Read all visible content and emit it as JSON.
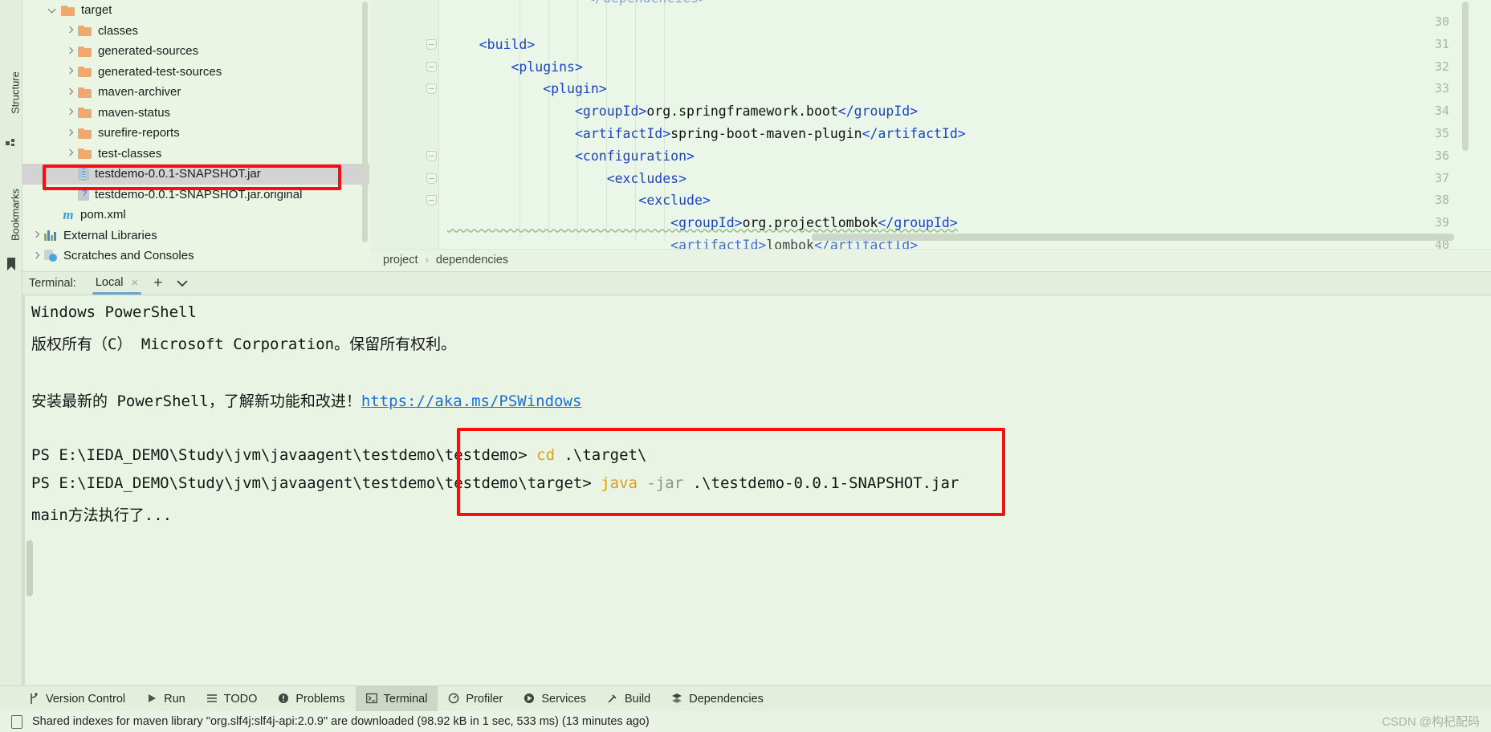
{
  "left_tool_strip": {
    "items": [
      {
        "label": "Structure",
        "icon": "structure-icon"
      },
      {
        "label": "Bookmarks",
        "icon": "bookmark-icon"
      }
    ]
  },
  "project_tree": {
    "rows": [
      {
        "indent": 1,
        "chevron": "down",
        "icon": "folder-icon",
        "label": "target",
        "selected": false
      },
      {
        "indent": 2,
        "chevron": "right",
        "icon": "folder-icon",
        "label": "classes",
        "selected": false
      },
      {
        "indent": 2,
        "chevron": "right",
        "icon": "folder-icon",
        "label": "generated-sources",
        "selected": false
      },
      {
        "indent": 2,
        "chevron": "right",
        "icon": "folder-icon",
        "label": "generated-test-sources",
        "selected": false
      },
      {
        "indent": 2,
        "chevron": "right",
        "icon": "folder-icon",
        "label": "maven-archiver",
        "selected": false
      },
      {
        "indent": 2,
        "chevron": "right",
        "icon": "folder-icon",
        "label": "maven-status",
        "selected": false
      },
      {
        "indent": 2,
        "chevron": "right",
        "icon": "folder-icon",
        "label": "surefire-reports",
        "selected": false
      },
      {
        "indent": 2,
        "chevron": "right",
        "icon": "folder-icon",
        "label": "test-classes",
        "selected": false
      },
      {
        "indent": 2,
        "chevron": "none",
        "icon": "jar-file-icon",
        "label": "testdemo-0.0.1-SNAPSHOT.jar",
        "selected": true
      },
      {
        "indent": 2,
        "chevron": "none",
        "icon": "unknown-file-icon",
        "label": "testdemo-0.0.1-SNAPSHOT.jar.original",
        "selected": false
      },
      {
        "indent": 1,
        "chevron": "none",
        "icon": "maven-icon",
        "label": "pom.xml",
        "selected": false
      },
      {
        "indent": 0,
        "chevron": "right",
        "icon": "library-icon",
        "label": "External Libraries",
        "selected": false
      },
      {
        "indent": 0,
        "chevron": "right",
        "icon": "scratches-icon",
        "label": "Scratches and Consoles",
        "selected": false
      }
    ]
  },
  "editor": {
    "lines": [
      {
        "num": "30",
        "fold": false,
        "text": ""
      },
      {
        "num": "31",
        "fold": true,
        "text": "    <build>"
      },
      {
        "num": "32",
        "fold": true,
        "text": "        <plugins>"
      },
      {
        "num": "33",
        "fold": true,
        "text": "            <plugin>"
      },
      {
        "num": "34",
        "fold": false,
        "text": "                <groupId>org.springframework.boot</groupId>"
      },
      {
        "num": "35",
        "fold": false,
        "text": "                <artifactId>spring-boot-maven-plugin</artifactId>"
      },
      {
        "num": "36",
        "fold": true,
        "text": "                <configuration>"
      },
      {
        "num": "37",
        "fold": true,
        "text": "                    <excludes>"
      },
      {
        "num": "38",
        "fold": true,
        "text": "                        <exclude>"
      },
      {
        "num": "39",
        "fold": false,
        "text": "                            <groupId>org.projectlombok</groupId>"
      },
      {
        "num": "40",
        "fold": false,
        "text": "                            <artifactId>lombok</artifactId>"
      }
    ],
    "partial_top_line": "</dependencies>"
  },
  "breadcrumb": {
    "items": [
      "project",
      "dependencies"
    ],
    "separator": "›"
  },
  "terminal_tabbar": {
    "label": "Terminal:",
    "tab": "Local",
    "close": "×",
    "add": "+",
    "dropdown": "⌄"
  },
  "terminal": {
    "lines": [
      {
        "type": "plain",
        "text": "Windows PowerShell"
      },
      {
        "type": "plain",
        "text": "版权所有（C） Microsoft Corporation。保留所有权利。"
      },
      {
        "type": "blank",
        "text": ""
      },
      {
        "type": "link_line",
        "prefix": "安装最新的 PowerShell，了解新功能和改进！",
        "link": "https://aka.ms/PSWindows"
      },
      {
        "type": "blank",
        "text": ""
      },
      {
        "type": "prompt",
        "prompt": "PS E:\\IEDA_DEMO\\Study\\jvm\\javaagent\\testdemo\\testdemo> ",
        "cmd": "cd",
        "args": " .\\target\\"
      },
      {
        "type": "prompt",
        "prompt": "PS E:\\IEDA_DEMO\\Study\\jvm\\javaagent\\testdemo\\testdemo\\target> ",
        "cmd": "java",
        "flag": " -jar",
        "args": " .\\testdemo-0.0.1-SNAPSHOT.jar"
      },
      {
        "type": "plain",
        "text": "main方法执行了..."
      }
    ]
  },
  "annotations": {
    "jar_highlight": {
      "name": "jar-file-highlight"
    },
    "command_highlight": {
      "name": "terminal-command-highlight"
    },
    "color": "#fb0d0d"
  },
  "bottom_bar": {
    "items": [
      {
        "label": "Version Control",
        "icon": "branch-icon",
        "active": false
      },
      {
        "label": "Run",
        "icon": "play-icon",
        "active": false
      },
      {
        "label": "TODO",
        "icon": "list-icon",
        "active": false
      },
      {
        "label": "Problems",
        "icon": "warning-icon",
        "active": false
      },
      {
        "label": "Terminal",
        "icon": "terminal-icon",
        "active": true
      },
      {
        "label": "Profiler",
        "icon": "profiler-icon",
        "active": false
      },
      {
        "label": "Services",
        "icon": "services-icon",
        "active": false
      },
      {
        "label": "Build",
        "icon": "hammer-icon",
        "active": false
      },
      {
        "label": "Dependencies",
        "icon": "dependencies-icon",
        "active": false
      }
    ]
  },
  "status_bar": {
    "message": "Shared indexes for maven library \"org.slf4j:slf4j-api:2.0.9\" are downloaded (98.92 kB in 1 sec, 533 ms) (13 minutes ago)",
    "icon": "indexes-icon"
  },
  "watermark": {
    "text": "CSDN @构杞配码"
  }
}
